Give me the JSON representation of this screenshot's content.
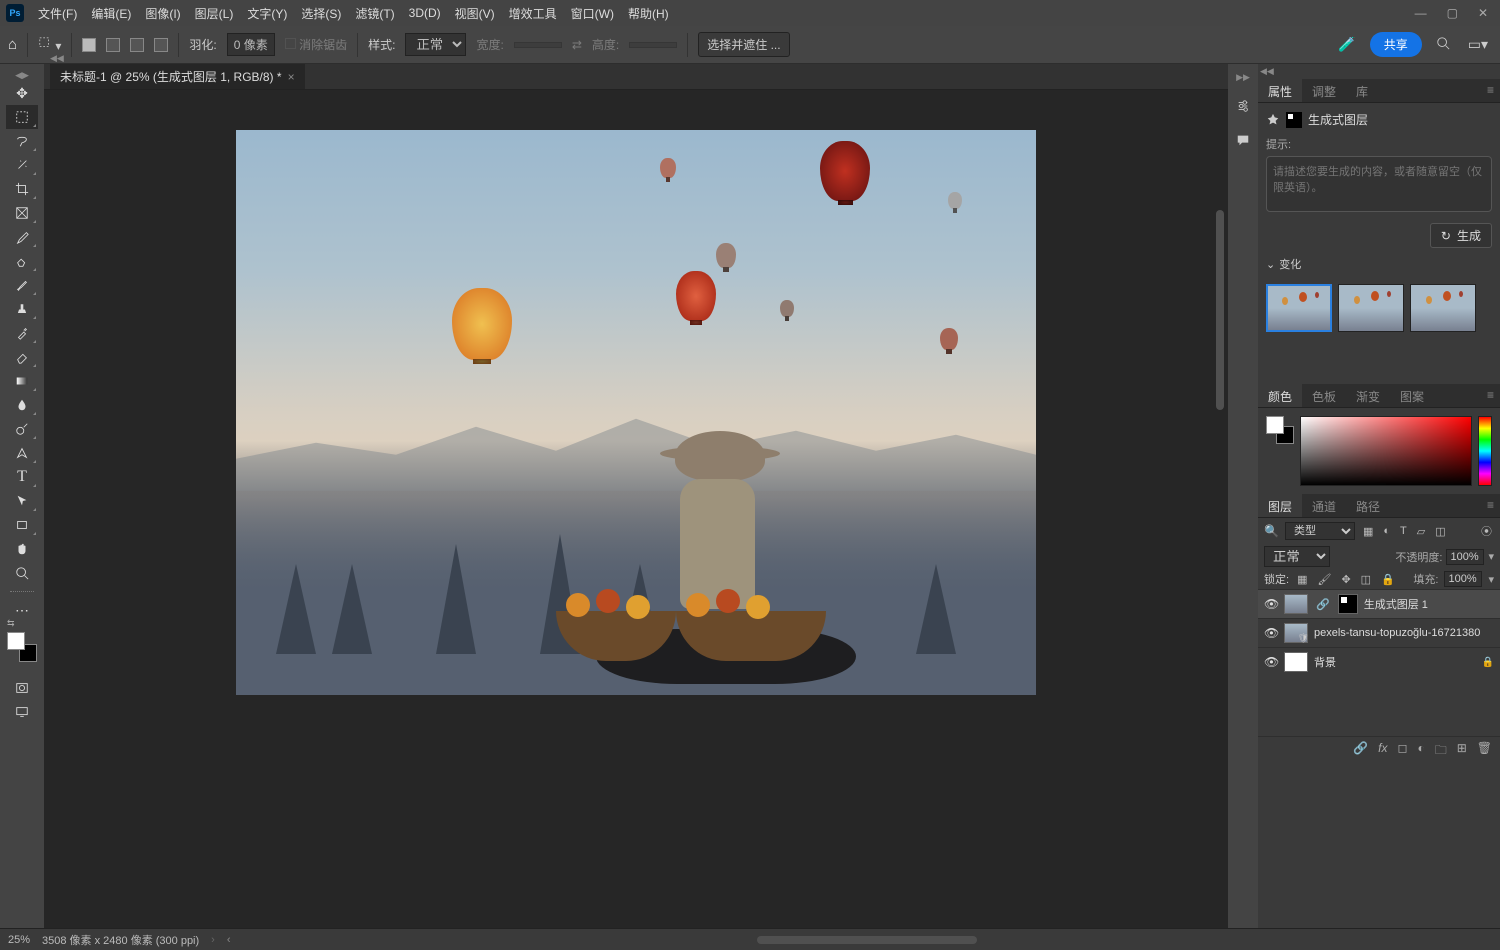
{
  "menubar": {
    "items": [
      "文件(F)",
      "编辑(E)",
      "图像(I)",
      "图层(L)",
      "文字(Y)",
      "选择(S)",
      "滤镜(T)",
      "3D(D)",
      "视图(V)",
      "增效工具",
      "窗口(W)",
      "帮助(H)"
    ]
  },
  "optionsbar": {
    "feather_label": "羽化:",
    "feather_value": "0 像素",
    "antialias_label": "消除锯齿",
    "style_label": "样式:",
    "style_value": "正常",
    "width_label": "宽度:",
    "height_label": "高度:",
    "select_mask_btn": "选择并遮住 ...",
    "share_btn": "共享"
  },
  "document": {
    "tab_label": "未标题-1 @ 25% (生成式图层 1, RGB/8) *"
  },
  "properties_panel": {
    "tabs": [
      "属性",
      "调整",
      "库"
    ],
    "header_label": "生成式图层",
    "prompt_label": "提示:",
    "prompt_placeholder": "请描述您要生成的内容，或者随意留空（仅限英语）。",
    "generate_btn": "生成",
    "variations_label": "变化"
  },
  "color_panel": {
    "tabs": [
      "颜色",
      "色板",
      "渐变",
      "图案"
    ]
  },
  "layers_panel": {
    "tabs": [
      "图层",
      "通道",
      "路径"
    ],
    "filter_label": "类型",
    "blend_mode": "正常",
    "opacity_label": "不透明度:",
    "opacity_value": "100%",
    "lock_label": "锁定:",
    "fill_label": "填充:",
    "fill_value": "100%",
    "layers": [
      {
        "name": "生成式图层 1",
        "selected": true,
        "has_mask": true,
        "thumb": "gen"
      },
      {
        "name": "pexels-tansu-topuzoğlu-16721380",
        "selected": false,
        "has_mask": false,
        "thumb": "sm",
        "smart": true
      },
      {
        "name": "背景",
        "selected": false,
        "has_mask": false,
        "locked": true,
        "thumb": "so"
      }
    ]
  },
  "statusbar": {
    "zoom": "25%",
    "dims": "3508 像素 x 2480 像素 (300 ppi)"
  }
}
